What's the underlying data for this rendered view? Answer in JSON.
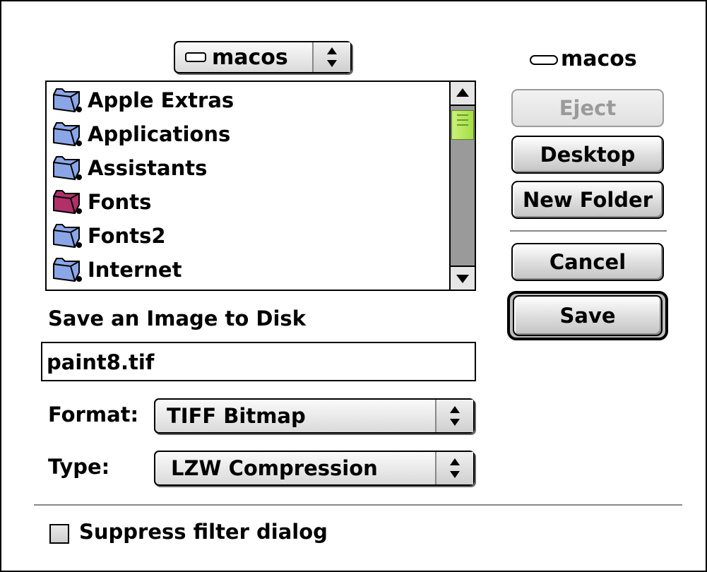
{
  "volume_popup": {
    "label": "macos"
  },
  "disk_label": "macos",
  "file_list": {
    "items": [
      {
        "name": "Apple Extras",
        "color": "#8aa6e6"
      },
      {
        "name": "Applications",
        "color": "#8aa6e6"
      },
      {
        "name": "Assistants",
        "color": "#8aa6e6"
      },
      {
        "name": "Fonts",
        "color": "#b0306a"
      },
      {
        "name": "Fonts2",
        "color": "#8aa6e6"
      },
      {
        "name": "Internet",
        "color": "#8aa6e6"
      }
    ]
  },
  "buttons": {
    "eject": "Eject",
    "desktop": "Desktop",
    "new_folder": "New Folder",
    "cancel": "Cancel",
    "save": "Save"
  },
  "prompt": "Save an Image to Disk",
  "filename": {
    "value": "paint8.tif"
  },
  "format": {
    "label": "Format:",
    "value": "TIFF Bitmap"
  },
  "type": {
    "label": "Type:",
    "value": "LZW Compression"
  },
  "suppress": {
    "label": "Suppress filter dialog",
    "checked": false
  }
}
